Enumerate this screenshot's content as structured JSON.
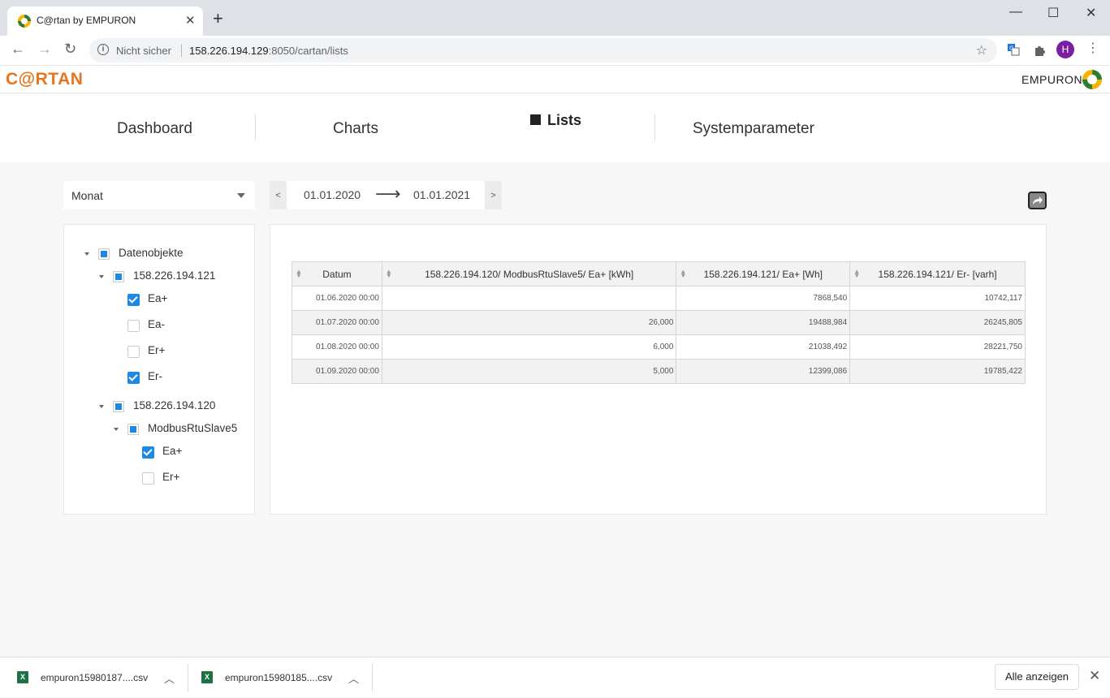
{
  "browser": {
    "tab_title": "C@rtan by EMPURON",
    "tab_close": "✕",
    "new_tab": "+",
    "window": {
      "minimize": "—",
      "maximize": "☐",
      "close": "✕"
    },
    "nav": {
      "back": "←",
      "forward": "→",
      "reload": "↻"
    },
    "security_label": "Nicht sicher",
    "url_host": "158.226.194.129",
    "url_rest": ":8050/cartan/lists",
    "profile_initial": "H",
    "menu": "⋮",
    "bookmark": "☆"
  },
  "app": {
    "logo_text": "C@RTAN",
    "brand_text": "EMPURON",
    "accent_color": "#e8741e",
    "check_color": "#1e88e5"
  },
  "nav": {
    "dashboard": "Dashboard",
    "charts": "Charts",
    "lists": "Lists",
    "systemparameter": "Systemparameter",
    "active": "Lists"
  },
  "filters": {
    "period": "Monat",
    "prev": "<",
    "next": ">",
    "date_from": "01.01.2020",
    "date_arrow": "⟶",
    "date_to": "01.01.2021"
  },
  "tree": {
    "root": {
      "label": "Datenobjekte",
      "state": "partial"
    },
    "device1": {
      "label": "158.226.194.121",
      "state": "partial"
    },
    "d1_ea_plus": {
      "label": "Ea+",
      "checked": true
    },
    "d1_ea_minus": {
      "label": "Ea-",
      "checked": false
    },
    "d1_er_plus": {
      "label": "Er+",
      "checked": false
    },
    "d1_er_minus": {
      "label": "Er-",
      "checked": true
    },
    "device2": {
      "label": "158.226.194.120",
      "state": "partial"
    },
    "slave": {
      "label": "ModbusRtuSlave5",
      "state": "partial"
    },
    "s_ea_plus": {
      "label": "Ea+",
      "checked": true
    },
    "s_er_plus": {
      "label": "Er+",
      "checked": false
    }
  },
  "table": {
    "headers": [
      "Datum",
      "158.226.194.120/ ModbusRtuSlave5/ Ea+ [kWh]",
      "158.226.194.121/ Ea+ [Wh]",
      "158.226.194.121/ Er- [varh]"
    ],
    "rows": [
      [
        "01.06.2020 00:00",
        "",
        "7868,540",
        "10742,117"
      ],
      [
        "01.07.2020 00:00",
        "26,000",
        "19488,984",
        "26245,805"
      ],
      [
        "01.08.2020 00:00",
        "6,000",
        "21038,492",
        "28221,750"
      ],
      [
        "01.09.2020 00:00",
        "5,000",
        "12399,086",
        "19785,422"
      ]
    ]
  },
  "downloads": {
    "items": [
      {
        "name": "empuron15980187....csv"
      },
      {
        "name": "empuron15980185....csv"
      }
    ],
    "show_all": "Alle anzeigen",
    "close": "✕"
  }
}
